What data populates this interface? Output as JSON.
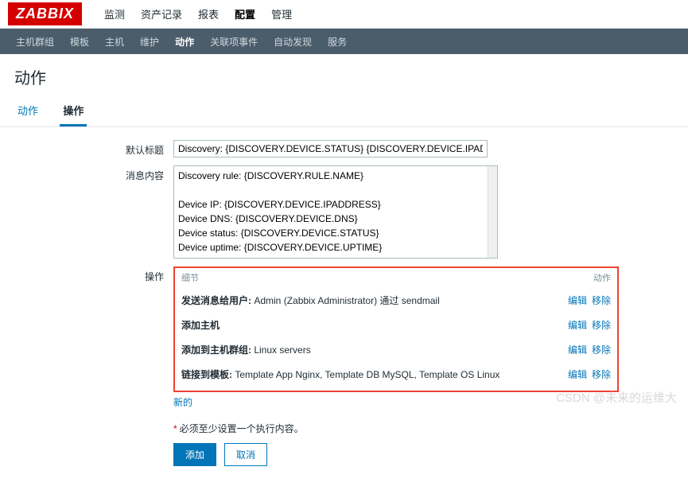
{
  "logo": "ZABBIX",
  "topnav": {
    "items": [
      "监测",
      "资产记录",
      "报表",
      "配置",
      "管理"
    ],
    "active": "配置"
  },
  "subnav": {
    "items": [
      "主机群组",
      "模板",
      "主机",
      "维护",
      "动作",
      "关联项事件",
      "自动发现",
      "服务"
    ],
    "active": "动作"
  },
  "page_title": "动作",
  "tabs": {
    "items": [
      "动作",
      "操作"
    ],
    "active": "操作"
  },
  "form": {
    "title_label": "默认标题",
    "title_value": "Discovery: {DISCOVERY.DEVICE.STATUS} {DISCOVERY.DEVICE.IPADDRESS}",
    "msg_label": "消息内容",
    "msg_value": "Discovery rule: {DISCOVERY.RULE.NAME}\n\nDevice IP: {DISCOVERY.DEVICE.IPADDRESS}\nDevice DNS: {DISCOVERY.DEVICE.DNS}\nDevice status: {DISCOVERY.DEVICE.STATUS}\nDevice uptime: {DISCOVERY.DEVICE.UPTIME}\n\nDevice service name: {DISCOVERY.SERVICE.NAME}",
    "ops_label": "操作",
    "ops_header_detail": "细节",
    "ops_header_actions": "动作",
    "ops": [
      {
        "label": "发送消息给用户:",
        "value": "Admin (Zabbix Administrator) 通过 sendmail"
      },
      {
        "label": "添加主机",
        "value": ""
      },
      {
        "label": "添加到主机群组:",
        "value": "Linux servers"
      },
      {
        "label": "链接到模板:",
        "value": "Template App Nginx, Template DB MySQL, Template OS Linux"
      }
    ],
    "op_edit": "编辑",
    "op_remove": "移除",
    "op_new": "新的",
    "hint": "必须至少设置一个执行内容。",
    "btn_add": "添加",
    "btn_cancel": "取消"
  },
  "watermark": "CSDN @未来的运维大"
}
